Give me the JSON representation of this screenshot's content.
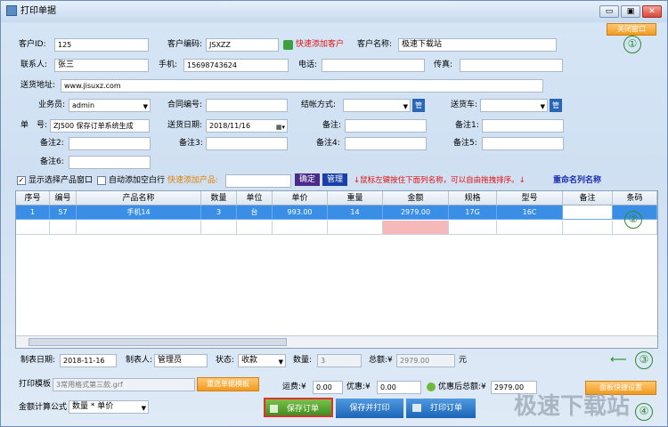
{
  "window": {
    "title": "打印单据",
    "close_window_label": "关闭窗口",
    "minimize": "▭",
    "maximize": "▣",
    "close": "✕"
  },
  "markers": [
    "①",
    "②",
    "③",
    "④"
  ],
  "form": {
    "customer_id_label": "客户ID:",
    "customer_id": "125",
    "customer_code_label": "客户编码:",
    "customer_code": "JSXZZ",
    "quick_add_customer": "快速添加客户",
    "customer_name_label": "客户名称:",
    "customer_name": "极速下载站",
    "contact_label": "联系人:",
    "contact": "张三",
    "phone_label": "手机:",
    "phone": "15698743624",
    "tel_label": "电话:",
    "tel": "",
    "fax_label": "传真:",
    "fax": "",
    "address_label": "送货地址:",
    "address": "www.jisuxz.com",
    "salesman_label": "业务员:",
    "salesman": "admin",
    "contract_label": "合同编号:",
    "contract": "",
    "settlement_label": "结帐方式:",
    "settlement": "",
    "manage_short": "管",
    "delivery_car_label": "送货车:",
    "delivery_car": "",
    "order_no_label": "单　号:",
    "order_no": "ZJ500 保存订单系统生成",
    "delivery_date_label": "送货日期:",
    "delivery_date": "2018/11/16",
    "remark_label": "备注:",
    "remark": "",
    "remark1_label": "备注1:",
    "remark1": "",
    "remark2_label": "备注2:",
    "remark2": "",
    "remark3_label": "备注3:",
    "remark3": "",
    "remark4_label": "备注4:",
    "remark4": "",
    "remark5_label": "备注5:",
    "remark5": "",
    "remark6_label": "备注6:",
    "remark6": ""
  },
  "toolbar": {
    "show_product_window": "显示选择产品窗口",
    "auto_add_blank": "自动添加空白行",
    "quick_add_product": "快速添加产品:",
    "confirm": "确定",
    "manage": "管理",
    "hint": "↓鼠标左键按住下面列名称，可以自由拖拽排序。↓",
    "rename_columns": "重命名列名称"
  },
  "table": {
    "headers": [
      "序号",
      "编号",
      "产品名称",
      "数量",
      "单位",
      "单价",
      "重量",
      "金额",
      "规格",
      "型号",
      "备注",
      "条码"
    ],
    "rows": [
      [
        "1",
        "57",
        "手机14",
        "3",
        "台",
        "993.00",
        "14",
        "2979.00",
        "17G",
        "16C",
        "",
        ""
      ]
    ]
  },
  "footer": {
    "made_date_label": "制表日期:",
    "made_date": "2018-11-16",
    "maker_label": "制表人:",
    "maker": "管理员",
    "status_label": "状态:",
    "status": "收款",
    "qty_label": "数量:",
    "qty": "3",
    "total_label": "总额:¥",
    "total": "2979.00",
    "yuan": "元",
    "template_label": "打印模板",
    "template": "3常用格式第三款.grf",
    "reselect_template": "重选单据模板",
    "freight_label": "运费:¥",
    "freight": "0.00",
    "discount_label": "优惠:¥",
    "discount": "0.00",
    "after_discount_label": "优惠后总额:¥",
    "after_discount": "2979.00",
    "panel_settings": "面板快捷设置",
    "formula_label": "金额计算公式",
    "formula": "数量 * 单价",
    "save_order": "保存订单",
    "save_print": "保存并打印",
    "print_order": "打印订单"
  },
  "watermark": "极速下载站"
}
